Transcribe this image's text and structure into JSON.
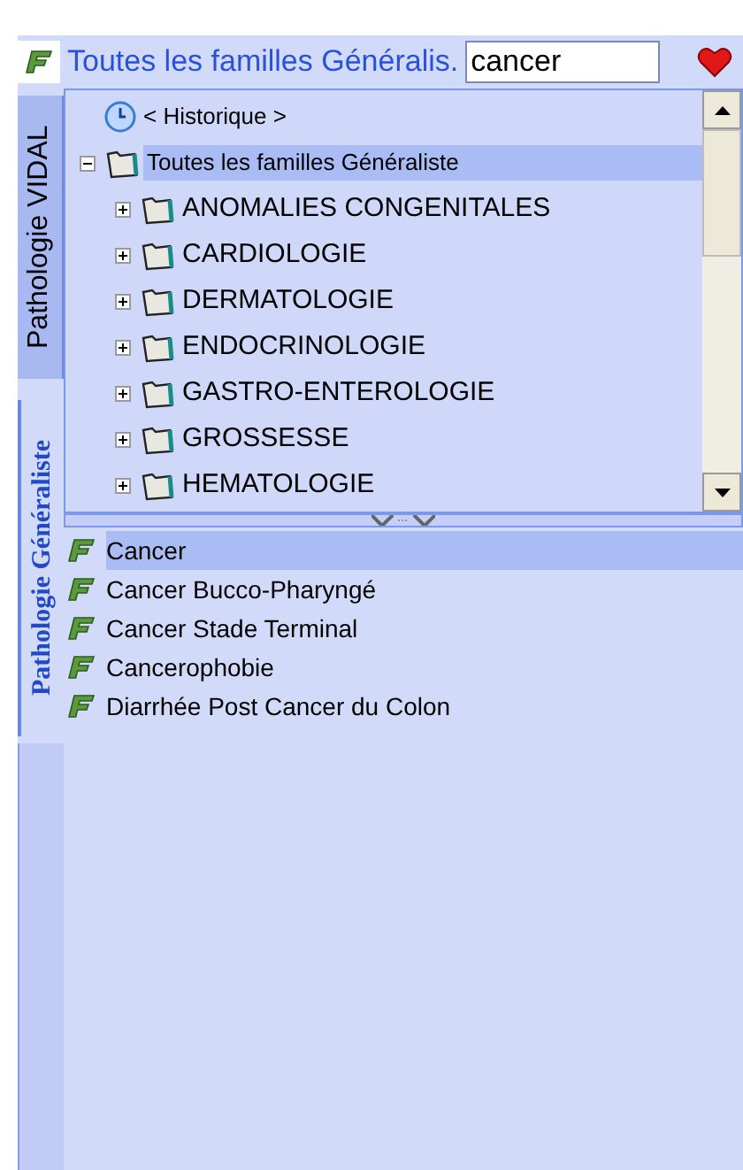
{
  "header": {
    "title": "Toutes les familles Généralis.",
    "search": {
      "value": "cancer"
    }
  },
  "side_tabs": [
    {
      "label": "Pathologie VIDAL",
      "selected": false
    },
    {
      "label": "Pathologie Généraliste",
      "selected": true
    }
  ],
  "tree": [
    {
      "label": "< Historique >",
      "kind": "history",
      "selected": false
    },
    {
      "label": "Toutes les familles Généraliste",
      "kind": "folder",
      "selected": true,
      "expanded": true,
      "children": [
        {
          "label": "ANOMALIES CONGENITALES",
          "kind": "folder",
          "selected": false,
          "expanded": false
        },
        {
          "label": "CARDIOLOGIE",
          "kind": "folder",
          "selected": false,
          "expanded": false
        },
        {
          "label": "DERMATOLOGIE",
          "kind": "folder",
          "selected": false,
          "expanded": false
        },
        {
          "label": "ENDOCRINOLOGIE",
          "kind": "folder",
          "selected": false,
          "expanded": false
        },
        {
          "label": "GASTRO-ENTEROLOGIE",
          "kind": "folder",
          "selected": false,
          "expanded": false
        },
        {
          "label": "GROSSESSE",
          "kind": "folder",
          "selected": false,
          "expanded": false
        },
        {
          "label": "HEMATOLOGIE",
          "kind": "folder",
          "selected": false,
          "expanded": false
        }
      ]
    }
  ],
  "results": [
    {
      "label": "Cancer",
      "selected": true
    },
    {
      "label": "Cancer Bucco-Pharyngé",
      "selected": false
    },
    {
      "label": "Cancer Stade Terminal",
      "selected": false
    },
    {
      "label": "Cancerophobie",
      "selected": false
    },
    {
      "label": "Diarrhée Post Cancer du Colon",
      "selected": false
    }
  ]
}
